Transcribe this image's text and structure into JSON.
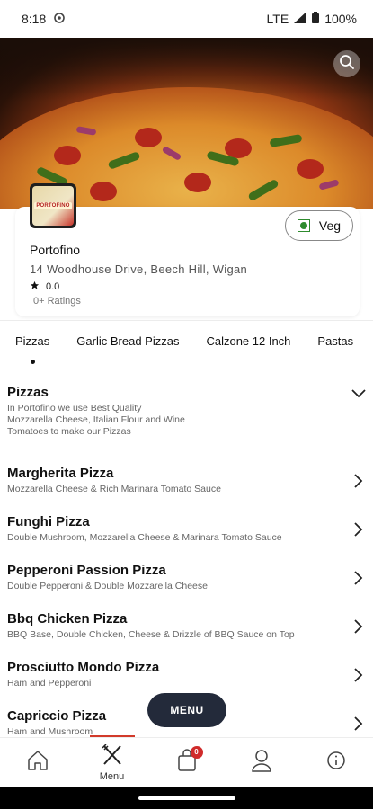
{
  "status_bar": {
    "time": "8:18",
    "network": "LTE",
    "battery": "100%"
  },
  "restaurant": {
    "name": "Portofino",
    "address": "14 Woodhouse Drive,  Beech Hill, Wigan",
    "rating": "0.0",
    "ratings_count": "0+ Ratings",
    "veg_label": "Veg",
    "logo_text": "PORTOFINO"
  },
  "tabs": [
    "Pizzas",
    "Garlic Bread Pizzas",
    "Calzone 12 Inch",
    "Pastas"
  ],
  "category": {
    "title": "Pizzas",
    "description": "In Portofino we use Best Quality Mozzarella Cheese, Italian Flour and Wine Tomatoes to make our Pizzas"
  },
  "items": [
    {
      "name": "Margherita Pizza",
      "desc": "Mozzarella Cheese & Rich Marinara Tomato Sauce"
    },
    {
      "name": "Funghi Pizza",
      "desc": "Double Mushroom, Mozzarella Cheese & Marinara Tomato Sauce"
    },
    {
      "name": "Pepperoni Passion Pizza",
      "desc": "Double Pepperoni & Double Mozzarella Cheese"
    },
    {
      "name": "Bbq Chicken Pizza",
      "desc": "BBQ Base, Double Chicken, Cheese & Drizzle of BBQ Sauce on Top"
    },
    {
      "name": "Prosciutto Mondo Pizza",
      "desc": "Ham and Pepperoni"
    },
    {
      "name": "Capriccio Pizza",
      "desc": "Ham and Mushroom"
    }
  ],
  "menu_button": "MENU",
  "bottom_nav": {
    "menu_label": "Menu",
    "cart_count": "0"
  },
  "colors": {
    "fab": "#232a3a",
    "badge": "#d02b2b",
    "veg": "#2e8b2e"
  }
}
